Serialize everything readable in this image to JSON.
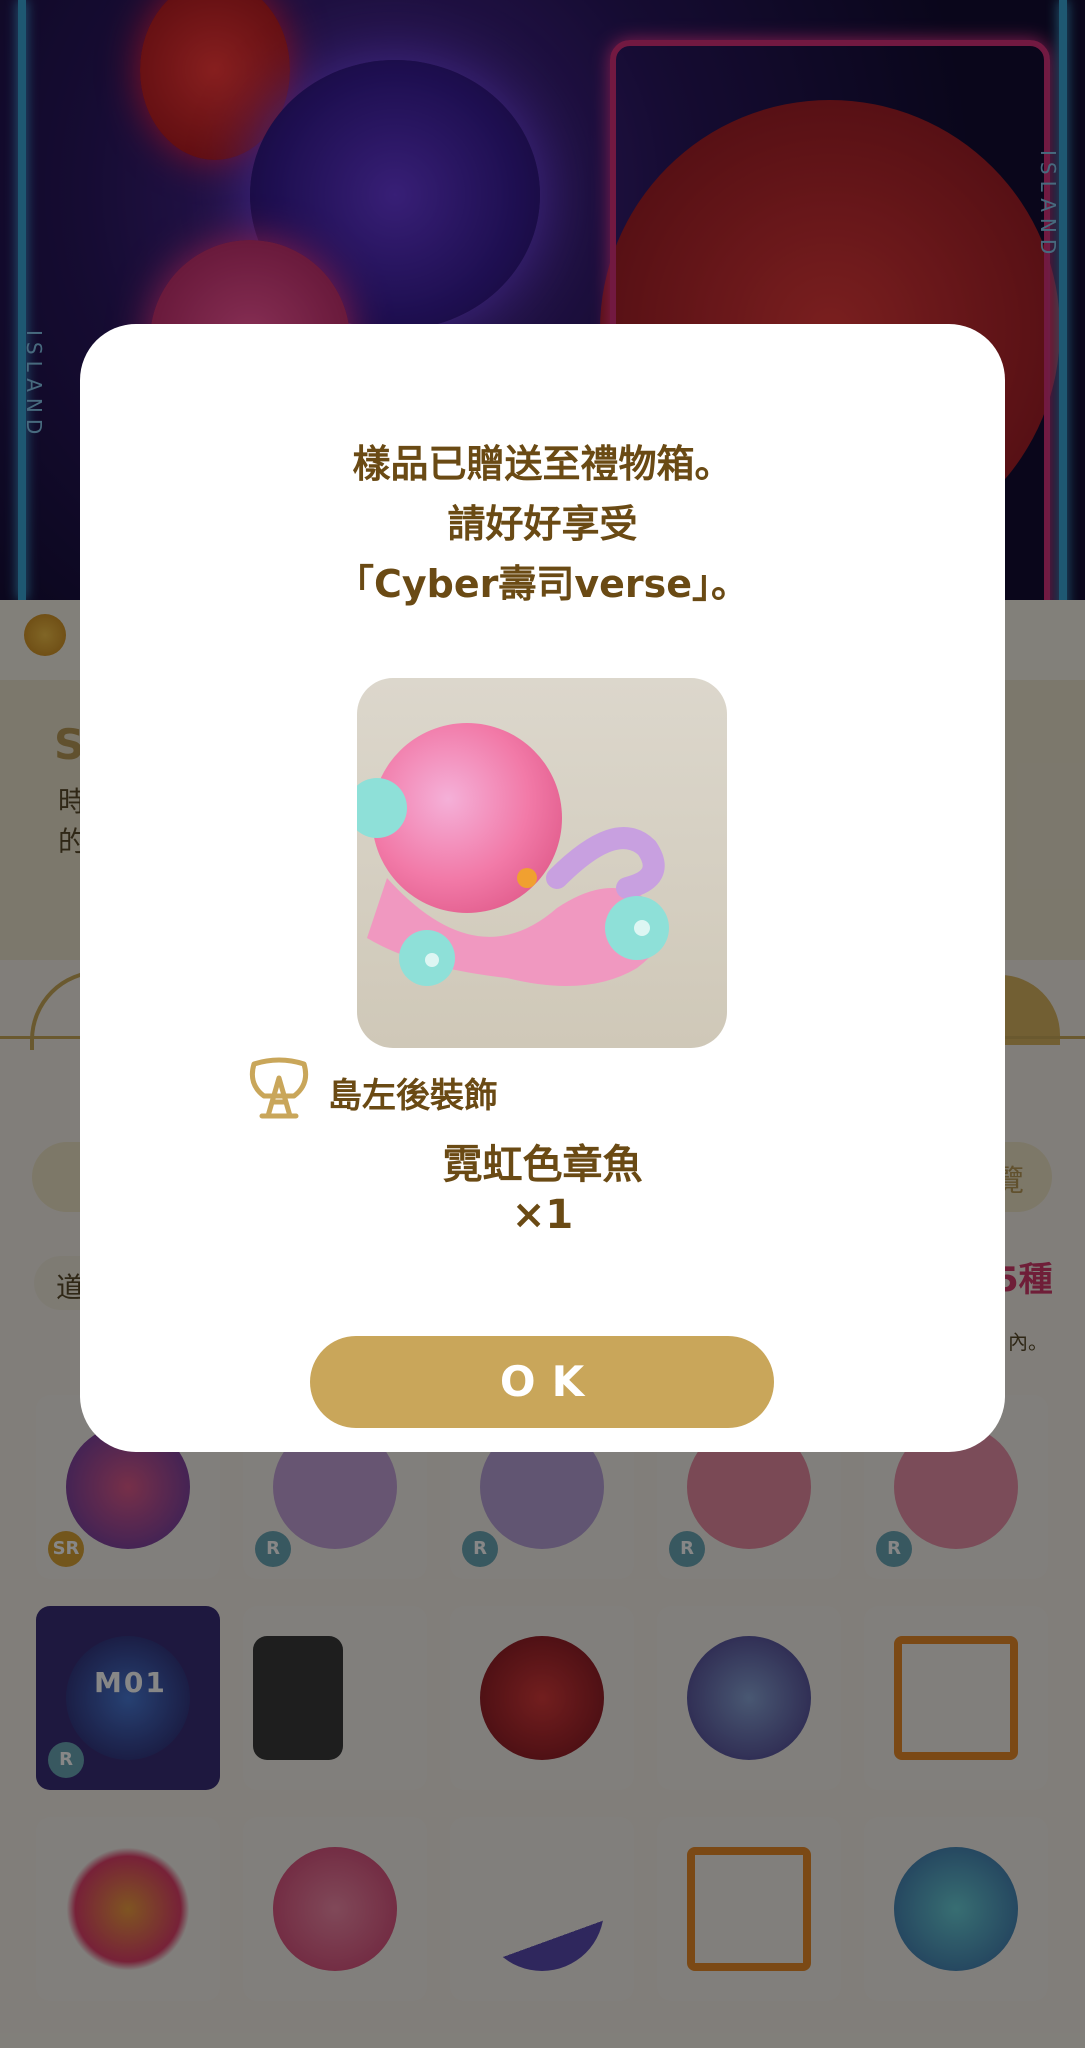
{
  "background": {
    "banner_side_text_left": "ISLAND",
    "banner_side_text_right": "ISLAND",
    "info_title_fragment": "S",
    "info_line1_fragment": "時",
    "info_line2_fragment": "的",
    "pill_right_fragment": "覽",
    "chip_fragment": "道",
    "count_fragment": "5種",
    "note_fragment": "內。",
    "grid_items": [
      {
        "badge": "SR",
        "label": ""
      },
      {
        "badge": "R",
        "label": ""
      },
      {
        "badge": "R",
        "label": ""
      },
      {
        "badge": "R",
        "label": ""
      },
      {
        "badge": "R",
        "label": ""
      },
      {
        "badge": "R",
        "label": "M01"
      },
      {
        "badge": "",
        "label": ""
      },
      {
        "badge": "",
        "label": ""
      },
      {
        "badge": "",
        "label": ""
      },
      {
        "badge": "",
        "label": ""
      },
      {
        "badge": "",
        "label": ""
      },
      {
        "badge": "",
        "label": ""
      },
      {
        "badge": "",
        "label": ""
      },
      {
        "badge": "",
        "label": ""
      },
      {
        "badge": "",
        "label": ""
      }
    ]
  },
  "dialog": {
    "message_line1": "樣品已贈送至禮物箱。",
    "message_line2": "請好好享受",
    "message_line3": "「Cyber壽司verse」。",
    "item_type_label": "島左後裝飾",
    "item_type_icon": "island-decoration-icon",
    "item_name": "霓虹色章魚",
    "item_quantity": "×1",
    "ok_label": "OK"
  },
  "colors": {
    "accent_gold": "#c9a65a",
    "text_brown": "#6a4a14",
    "overlay": "rgba(0,0,0,0.47)"
  }
}
